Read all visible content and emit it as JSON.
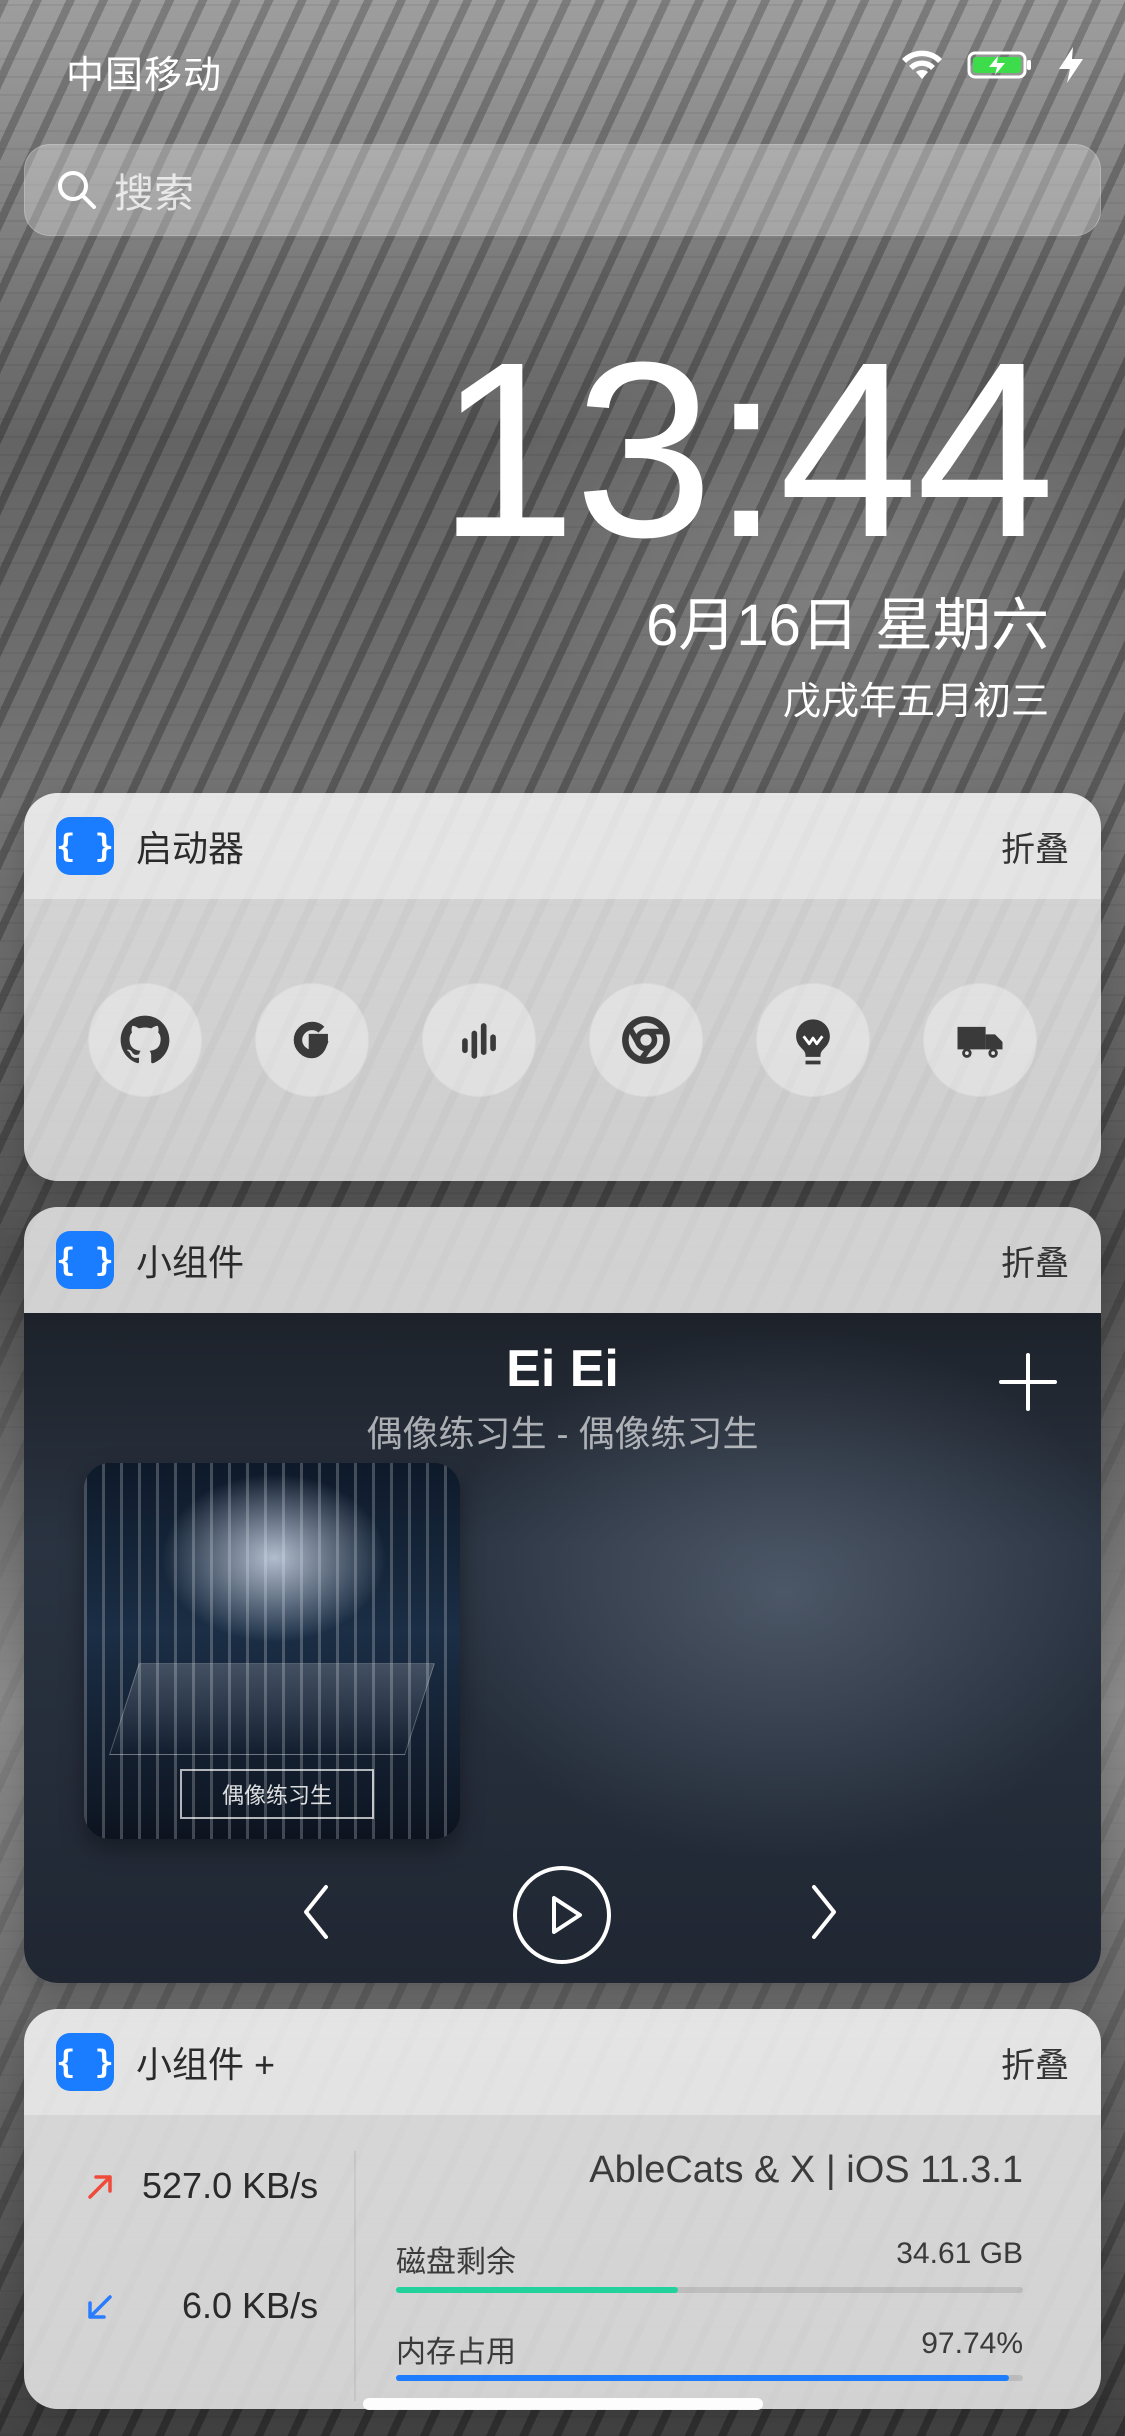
{
  "status_bar": {
    "carrier": "中国移动",
    "icons": [
      "wifi-icon",
      "battery-charging-icon",
      "charging-bolt-icon"
    ]
  },
  "search": {
    "placeholder": "搜索",
    "icon": "search-icon"
  },
  "today": {
    "time": "13:44",
    "date": "6月16日 星期六",
    "lunar": "戊戌年五月初三"
  },
  "widgets": {
    "launcher": {
      "title": "启动器",
      "collapse": "折叠",
      "app_icon_text": "{ }",
      "buttons": [
        {
          "icon": "github-icon"
        },
        {
          "icon": "google-icon"
        },
        {
          "icon": "podcast-icon"
        },
        {
          "icon": "chrome-icon"
        },
        {
          "icon": "lightbulb-icon"
        },
        {
          "icon": "truck-icon"
        }
      ]
    },
    "music_widget": {
      "title": "小组件",
      "collapse": "折叠",
      "app_icon_text": "{ }",
      "song_title": "Ei Ei",
      "artist": "偶像练习生 - 偶像练习生",
      "cover_logo_text": "偶像练习生",
      "controls": [
        "previous-icon",
        "play-icon",
        "next-icon"
      ],
      "add_icon": "plus-icon"
    },
    "stats_widget": {
      "title": "小组件 +",
      "collapse": "折叠",
      "app_icon_text": "{ }",
      "upload_speed": "527.0 KB/s",
      "download_speed": "6.0 KB/s",
      "device": "AbleCats & X | iOS 11.3.1",
      "disk_label": "磁盘剩余",
      "disk_value": "34.61 GB",
      "disk_progress": 0.45,
      "memory_label": "内存占用",
      "memory_value": "97.74%",
      "memory_progress": 0.9774,
      "colors": {
        "upload": "#f04a3a",
        "download": "#2a7cff",
        "disk_bar": "#22d19b",
        "memory_bar": "#1e7cff"
      }
    }
  }
}
